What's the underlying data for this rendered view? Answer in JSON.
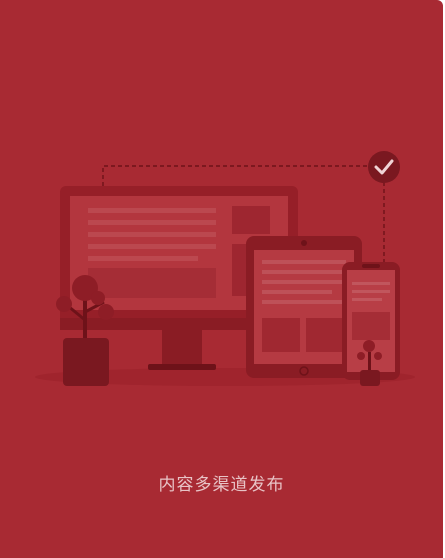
{
  "card": {
    "caption": "内容多渠道发布",
    "illustration_icon": "multi-device-publish-illustration",
    "check_icon": "check-icon"
  },
  "colors": {
    "background": "#a82a33",
    "caption_text": "#e8c3c6"
  }
}
